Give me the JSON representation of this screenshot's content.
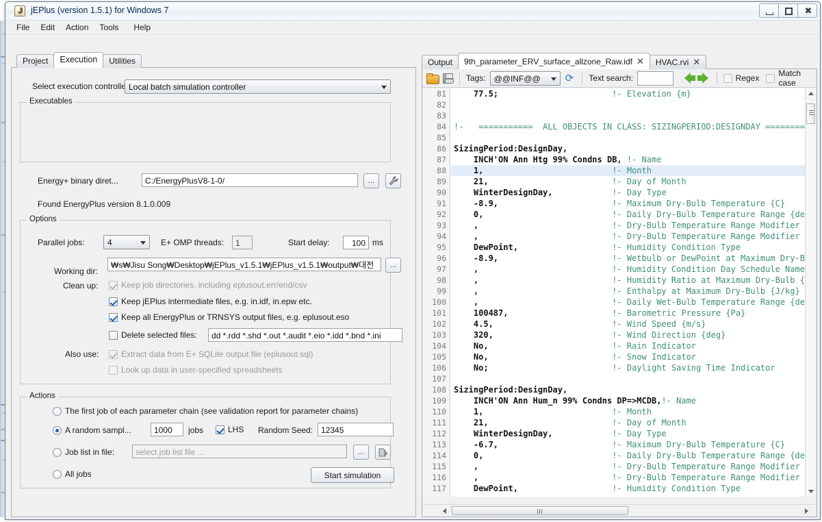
{
  "window": {
    "title": "jEPlus (version 1.5.1) for Windows 7",
    "app_icon": "java-coffee-icon",
    "minimize": "minimize-icon",
    "maximize": "maximize-icon",
    "close": "close-icon"
  },
  "menu": {
    "items": [
      "File",
      "Edit",
      "Action",
      "Tools",
      "Help"
    ]
  },
  "left": {
    "tabs": [
      {
        "label": "Project",
        "active": false
      },
      {
        "label": "Execution",
        "active": true
      },
      {
        "label": "Utilities",
        "active": false
      }
    ],
    "controller": {
      "label": "Select execution controller:",
      "value": "Local batch simulation controller"
    },
    "executables": {
      "title": "Executables",
      "binary_label": "Energy+ binary diret...",
      "binary_value": "C:/EnergyPlusV8-1-0/",
      "browse_label": "...",
      "tool_label": "wrench-icon",
      "found_text": "Found EnergyPlus version 8.1.0.009"
    },
    "options": {
      "title": "Options",
      "parallel_jobs_label": "Parallel jobs:",
      "parallel_jobs_value": "4",
      "omp_label": "E+ OMP threads:",
      "omp_value": "1",
      "start_delay_label": "Start delay:",
      "start_delay_value": "100",
      "start_delay_unit": "ms",
      "working_dir_label": "Working dir:",
      "working_dir_value": "s₩Jisu Song₩Desktop₩jEPlus_v1.5.1₩jEPlus_v1.5.1₩output₩대전₩",
      "working_dir_browse": "...",
      "cleanup_label": "Clean up:",
      "cleanup_items": [
        {
          "label": "Keep job directories, including eplusout.err/end/csv",
          "checked": true,
          "disabled": true
        },
        {
          "label": "Keep jEPlus intermediate files, e.g. in.idf, in.epw etc.",
          "checked": true,
          "disabled": false
        },
        {
          "label": "Keep all EnergyPlus or TRNSYS output files, e.g. eplusout.eso",
          "checked": true,
          "disabled": false
        }
      ],
      "delete_label": "Delete selected files:",
      "delete_checked": false,
      "delete_value": "dd *.rdd *.shd *.out *.audit *.eio *.idd *.bnd *.ini",
      "also_use_label": "Also use:",
      "also_use_items": [
        {
          "label": "Extract data from E+ SQLite output file (eplusout.sql)",
          "checked": true,
          "disabled": true
        },
        {
          "label": "Look up data in user-specified spreadsheets",
          "checked": false,
          "disabled": true
        }
      ]
    },
    "actions": {
      "title": "Actions",
      "options": [
        {
          "label": "The first job of each parameter chain (see validation report for parameter chains)",
          "selected": false
        },
        {
          "label": "A random sampl...",
          "selected": true
        },
        {
          "label": "Job list in file:",
          "selected": false
        },
        {
          "label": "All jobs",
          "selected": false
        }
      ],
      "random_jobs_value": "1000",
      "jobs_unit": "jobs",
      "lhs_label": "LHS",
      "lhs_checked": true,
      "seed_label": "Random Seed:",
      "seed_value": "12345",
      "joblist_placeholder": "select job list file ...",
      "joblist_browse": "...",
      "joblist_open": "open-file-icon",
      "start_button": "Start simulation"
    }
  },
  "right": {
    "tabs": [
      {
        "label": "Output",
        "active": false,
        "closable": false
      },
      {
        "label": "9th_parameter_ERV_surface_allzone_Raw.idf",
        "active": true,
        "closable": true
      },
      {
        "label": "HVAC.rvi",
        "active": false,
        "closable": true
      }
    ],
    "close_glyph": "✕",
    "toolbar": {
      "open_icon": "open-folder-icon",
      "save_icon": "save-icon",
      "tags_label": "Tags:",
      "tags_value": "@@INF@@",
      "refresh_icon": "refresh-icon",
      "search_label": "Text search:",
      "search_value": "",
      "prev_icon": "arrow-left-icon",
      "next_icon": "arrow-right-icon",
      "regex_label": "Regex",
      "regex_checked": false,
      "match_case_label": "Match case",
      "match_case_checked": false
    },
    "editor": {
      "first_line": 81,
      "highlight_line": 88,
      "lines": [
        {
          "n": 81,
          "code": "    77.5;",
          "comment": "!- Elevation {m}",
          "comment_col": 32
        },
        {
          "n": 82,
          "code": "",
          "comment": "",
          "comment_col": 0
        },
        {
          "n": 83,
          "code": "",
          "comment": "",
          "comment_col": 0
        },
        {
          "n": 84,
          "code": "",
          "comment": "!-   ===========  ALL OBJECTS IN CLASS: SIZINGPERIOD:DESIGNDAY =========",
          "comment_col": 0
        },
        {
          "n": 85,
          "code": "",
          "comment": "",
          "comment_col": 0
        },
        {
          "n": 86,
          "code": "SizingPeriod:DesignDay,",
          "comment": "",
          "comment_col": 0
        },
        {
          "n": 87,
          "code": "    INCH'ON Ann Htg 99% Condns DB,",
          "comment": "!- Name",
          "comment_col": 35
        },
        {
          "n": 88,
          "code": "    1,",
          "comment": "!- Month",
          "comment_col": 32
        },
        {
          "n": 89,
          "code": "    21,",
          "comment": "!- Day of Month",
          "comment_col": 32
        },
        {
          "n": 90,
          "code": "    WinterDesignDay,",
          "comment": "!- Day Type",
          "comment_col": 32
        },
        {
          "n": 91,
          "code": "    -8.9,",
          "comment": "!- Maximum Dry-Bulb Temperature {C}",
          "comment_col": 32
        },
        {
          "n": 92,
          "code": "    0,",
          "comment": "!- Daily Dry-Bulb Temperature Range {deltaC",
          "comment_col": 32
        },
        {
          "n": 93,
          "code": "    ,",
          "comment": "!- Dry-Bulb Temperature Range Modifier Type",
          "comment_col": 32
        },
        {
          "n": 94,
          "code": "    ,",
          "comment": "!- Dry-Bulb Temperature Range Modifier Day",
          "comment_col": 32
        },
        {
          "n": 95,
          "code": "    DewPoint,",
          "comment": "!- Humidity Condition Type",
          "comment_col": 32
        },
        {
          "n": 96,
          "code": "    -8.9,",
          "comment": "!- Wetbulb or DewPoint at Maximum Dry-Bulb",
          "comment_col": 32
        },
        {
          "n": 97,
          "code": "    ,",
          "comment": "!- Humidity Condition Day Schedule Name",
          "comment_col": 32
        },
        {
          "n": 98,
          "code": "    ,",
          "comment": "!- Humidity Ratio at Maximum Dry-Bulb {kgWa",
          "comment_col": 32
        },
        {
          "n": 99,
          "code": "    ,",
          "comment": "!- Enthalpy at Maximum Dry-Bulb {J/kg}",
          "comment_col": 32
        },
        {
          "n": 100,
          "code": "    ,",
          "comment": "!- Daily Wet-Bulb Temperature Range {deltaC",
          "comment_col": 32
        },
        {
          "n": 101,
          "code": "    100487,",
          "comment": "!- Barometric Pressure {Pa}",
          "comment_col": 32
        },
        {
          "n": 102,
          "code": "    4.5,",
          "comment": "!- Wind Speed {m/s}",
          "comment_col": 32
        },
        {
          "n": 103,
          "code": "    320,",
          "comment": "!- Wind Direction {deg}",
          "comment_col": 32
        },
        {
          "n": 104,
          "code": "    No,",
          "comment": "!- Rain Indicator",
          "comment_col": 32
        },
        {
          "n": 105,
          "code": "    No,",
          "comment": "!- Snow Indicator",
          "comment_col": 32
        },
        {
          "n": 106,
          "code": "    No;",
          "comment": "!- Daylight Saving Time Indicator",
          "comment_col": 32
        },
        {
          "n": 107,
          "code": "",
          "comment": "",
          "comment_col": 0
        },
        {
          "n": 108,
          "code": "SizingPeriod:DesignDay,",
          "comment": "",
          "comment_col": 0
        },
        {
          "n": 109,
          "code": "    INCH'ON Ann Hum_n 99% Condns DP=>MCDB,",
          "comment": "!- Name",
          "comment_col": 42
        },
        {
          "n": 110,
          "code": "    1,",
          "comment": "!- Month",
          "comment_col": 32
        },
        {
          "n": 111,
          "code": "    21,",
          "comment": "!- Day of Month",
          "comment_col": 32
        },
        {
          "n": 112,
          "code": "    WinterDesignDay,",
          "comment": "!- Day Type",
          "comment_col": 32
        },
        {
          "n": 113,
          "code": "    -6.7,",
          "comment": "!- Maximum Dry-Bulb Temperature {C}",
          "comment_col": 32
        },
        {
          "n": 114,
          "code": "    0,",
          "comment": "!- Daily Dry-Bulb Temperature Range {deltaC",
          "comment_col": 32
        },
        {
          "n": 115,
          "code": "    ,",
          "comment": "!- Dry-Bulb Temperature Range Modifier Type",
          "comment_col": 32
        },
        {
          "n": 116,
          "code": "    ,",
          "comment": "!- Dry-Bulb Temperature Range Modifier Day",
          "comment_col": 32
        },
        {
          "n": 117,
          "code": "    DewPoint,",
          "comment": "!- Humidity Condition Type",
          "comment_col": 32
        }
      ]
    }
  },
  "colors": {
    "accent": "#1b5fb5",
    "comment": "#3f8f7a",
    "highlight": "#e3edf9",
    "folder": "#e09b22",
    "arrow_green": "#5cb030",
    "title_text": "#0b2a52"
  }
}
